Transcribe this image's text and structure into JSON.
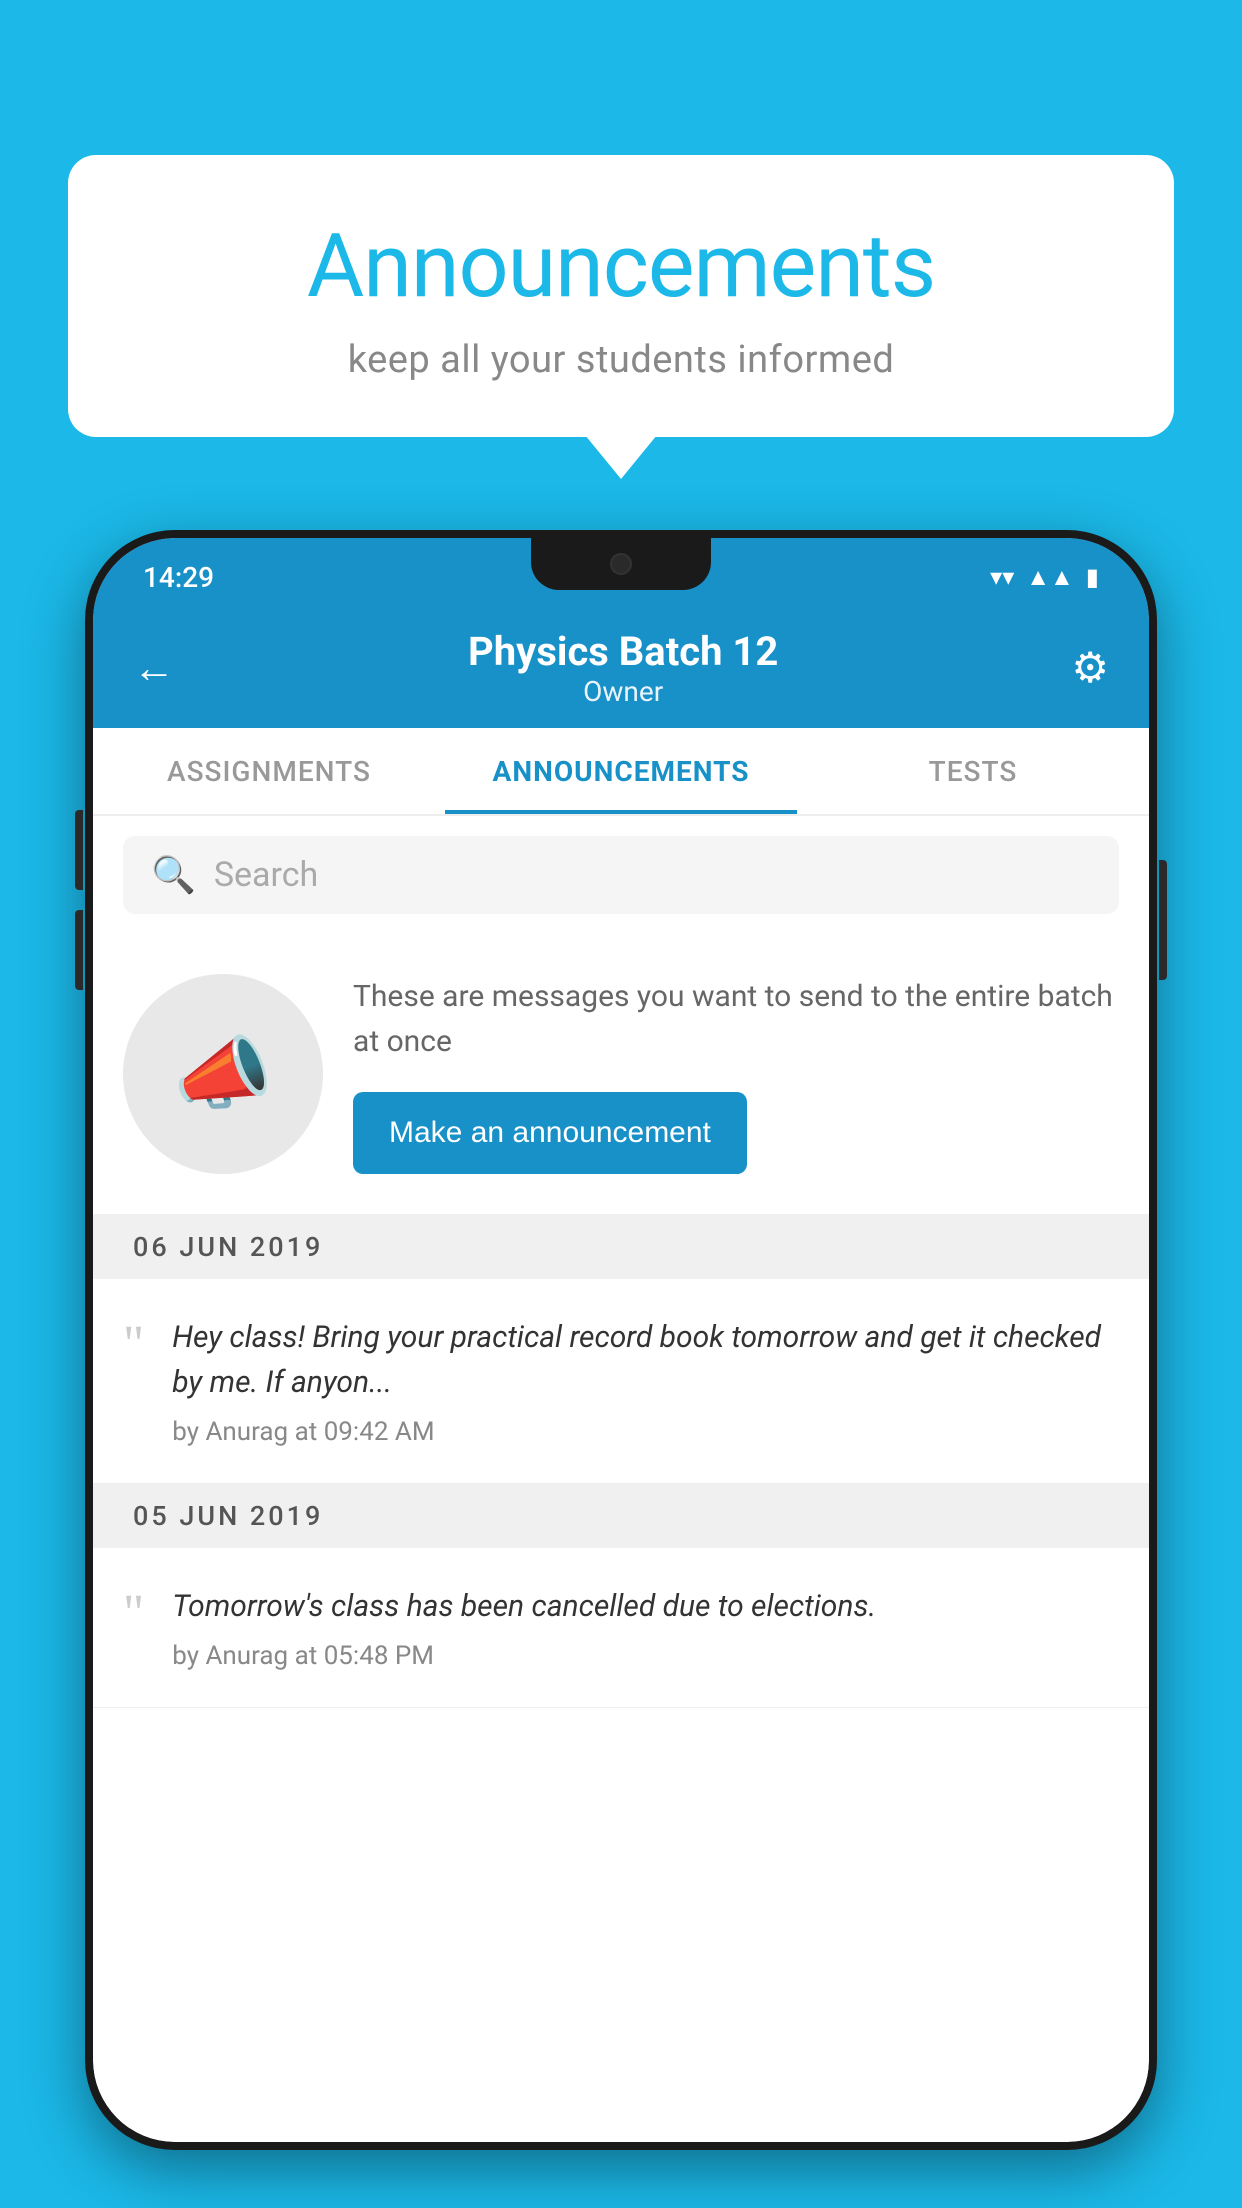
{
  "background_color": "#1BB8E8",
  "speech_bubble": {
    "title": "Announcements",
    "subtitle": "keep all your students informed"
  },
  "phone": {
    "status_bar": {
      "time": "14:29"
    },
    "header": {
      "title": "Physics Batch 12",
      "subtitle": "Owner",
      "back_label": "←",
      "gear_label": "⚙"
    },
    "tabs": [
      {
        "label": "ASSIGNMENTS",
        "active": false
      },
      {
        "label": "ANNOUNCEMENTS",
        "active": true
      },
      {
        "label": "TESTS",
        "active": false
      }
    ],
    "search": {
      "placeholder": "Search"
    },
    "announcement_prompt": {
      "description": "These are messages you want to send to the entire batch at once",
      "button_label": "Make an announcement"
    },
    "date_groups": [
      {
        "date": "06  JUN  2019",
        "items": [
          {
            "message": "Hey class! Bring your practical record book tomorrow and get it checked by me. If anyon...",
            "meta": "by Anurag at 09:42 AM"
          }
        ]
      },
      {
        "date": "05  JUN  2019",
        "items": [
          {
            "message": "Tomorrow's class has been cancelled due to elections.",
            "meta": "by Anurag at 05:48 PM"
          }
        ]
      }
    ]
  }
}
